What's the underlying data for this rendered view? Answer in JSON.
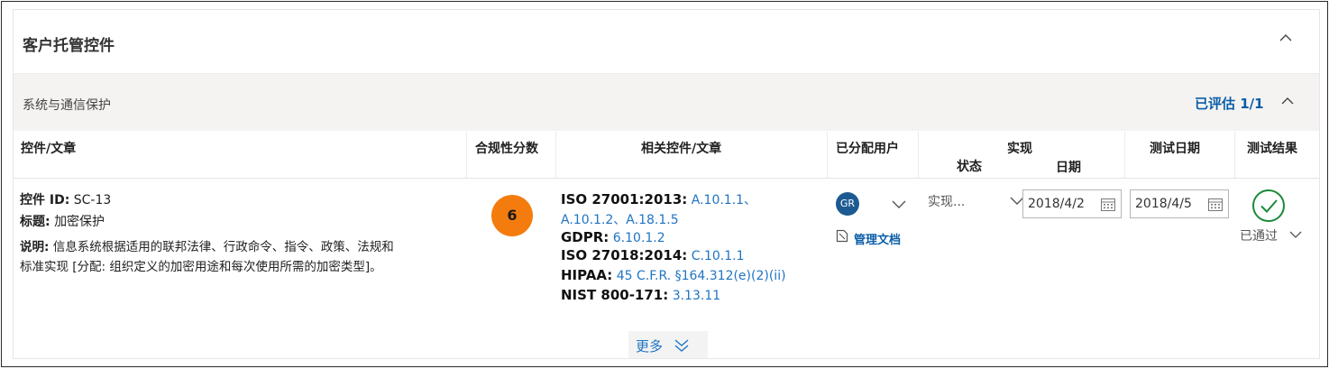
{
  "panel": {
    "title": "客户托管控件"
  },
  "section": {
    "title": "系统与通信保护",
    "status": "已评估 1/1"
  },
  "columns": {
    "control": "控件/文章",
    "score": "合规性分数",
    "related": "相关控件/文章",
    "assigned_user": "已分配用户",
    "implementation": "实现",
    "impl_status": "状态",
    "impl_date": "日期",
    "test_date": "测试日期",
    "test_result": "测试结果"
  },
  "row": {
    "control_id_label": "控件 ID:",
    "control_id": "SC-13",
    "title_label": "标题:",
    "title": "加密保护",
    "desc_label": "说明:",
    "desc_line1": "信息系统根据适用的联邦法律、行政命令、指令、政策、法规和",
    "desc_line2": "标准实现 [分配: 组织定义的加密用途和每次使用所需的加密类型]。",
    "score": "6",
    "related": [
      {
        "key": "ISO 27001:2013:",
        "value": "A.10.1.1、"
      },
      {
        "key": "",
        "value": "A.10.1.2、A.18.1.5"
      },
      {
        "key": "GDPR:",
        "value": "6.10.1.2"
      },
      {
        "key": "ISO 27018:2014:",
        "value": "C.10.1.1"
      },
      {
        "key": "HIPAA:",
        "value": "45 C.F.R. §164.312(e)(2)(ii)"
      },
      {
        "key": "NIST 800-171:",
        "value": "3.13.11"
      }
    ],
    "user_initials": "GR",
    "manage_docs": "管理文档",
    "impl_status": "实现...",
    "impl_date": "2018/4/2",
    "test_date": "2018/4/5",
    "test_result": "已通过"
  },
  "more_label": "更多",
  "colors": {
    "accent": "#0b5ea8",
    "link": "#1f74c2",
    "score_badge": "#f47c0f",
    "avatar": "#1d5a92",
    "pass": "#1a8a3a"
  },
  "icons": {
    "collapse": "chevron-up-icon",
    "dropdown": "chevron-down-icon",
    "calendar": "calendar-icon",
    "document": "document-icon",
    "passed": "check-circle-icon",
    "more": "double-chevron-down-icon"
  }
}
